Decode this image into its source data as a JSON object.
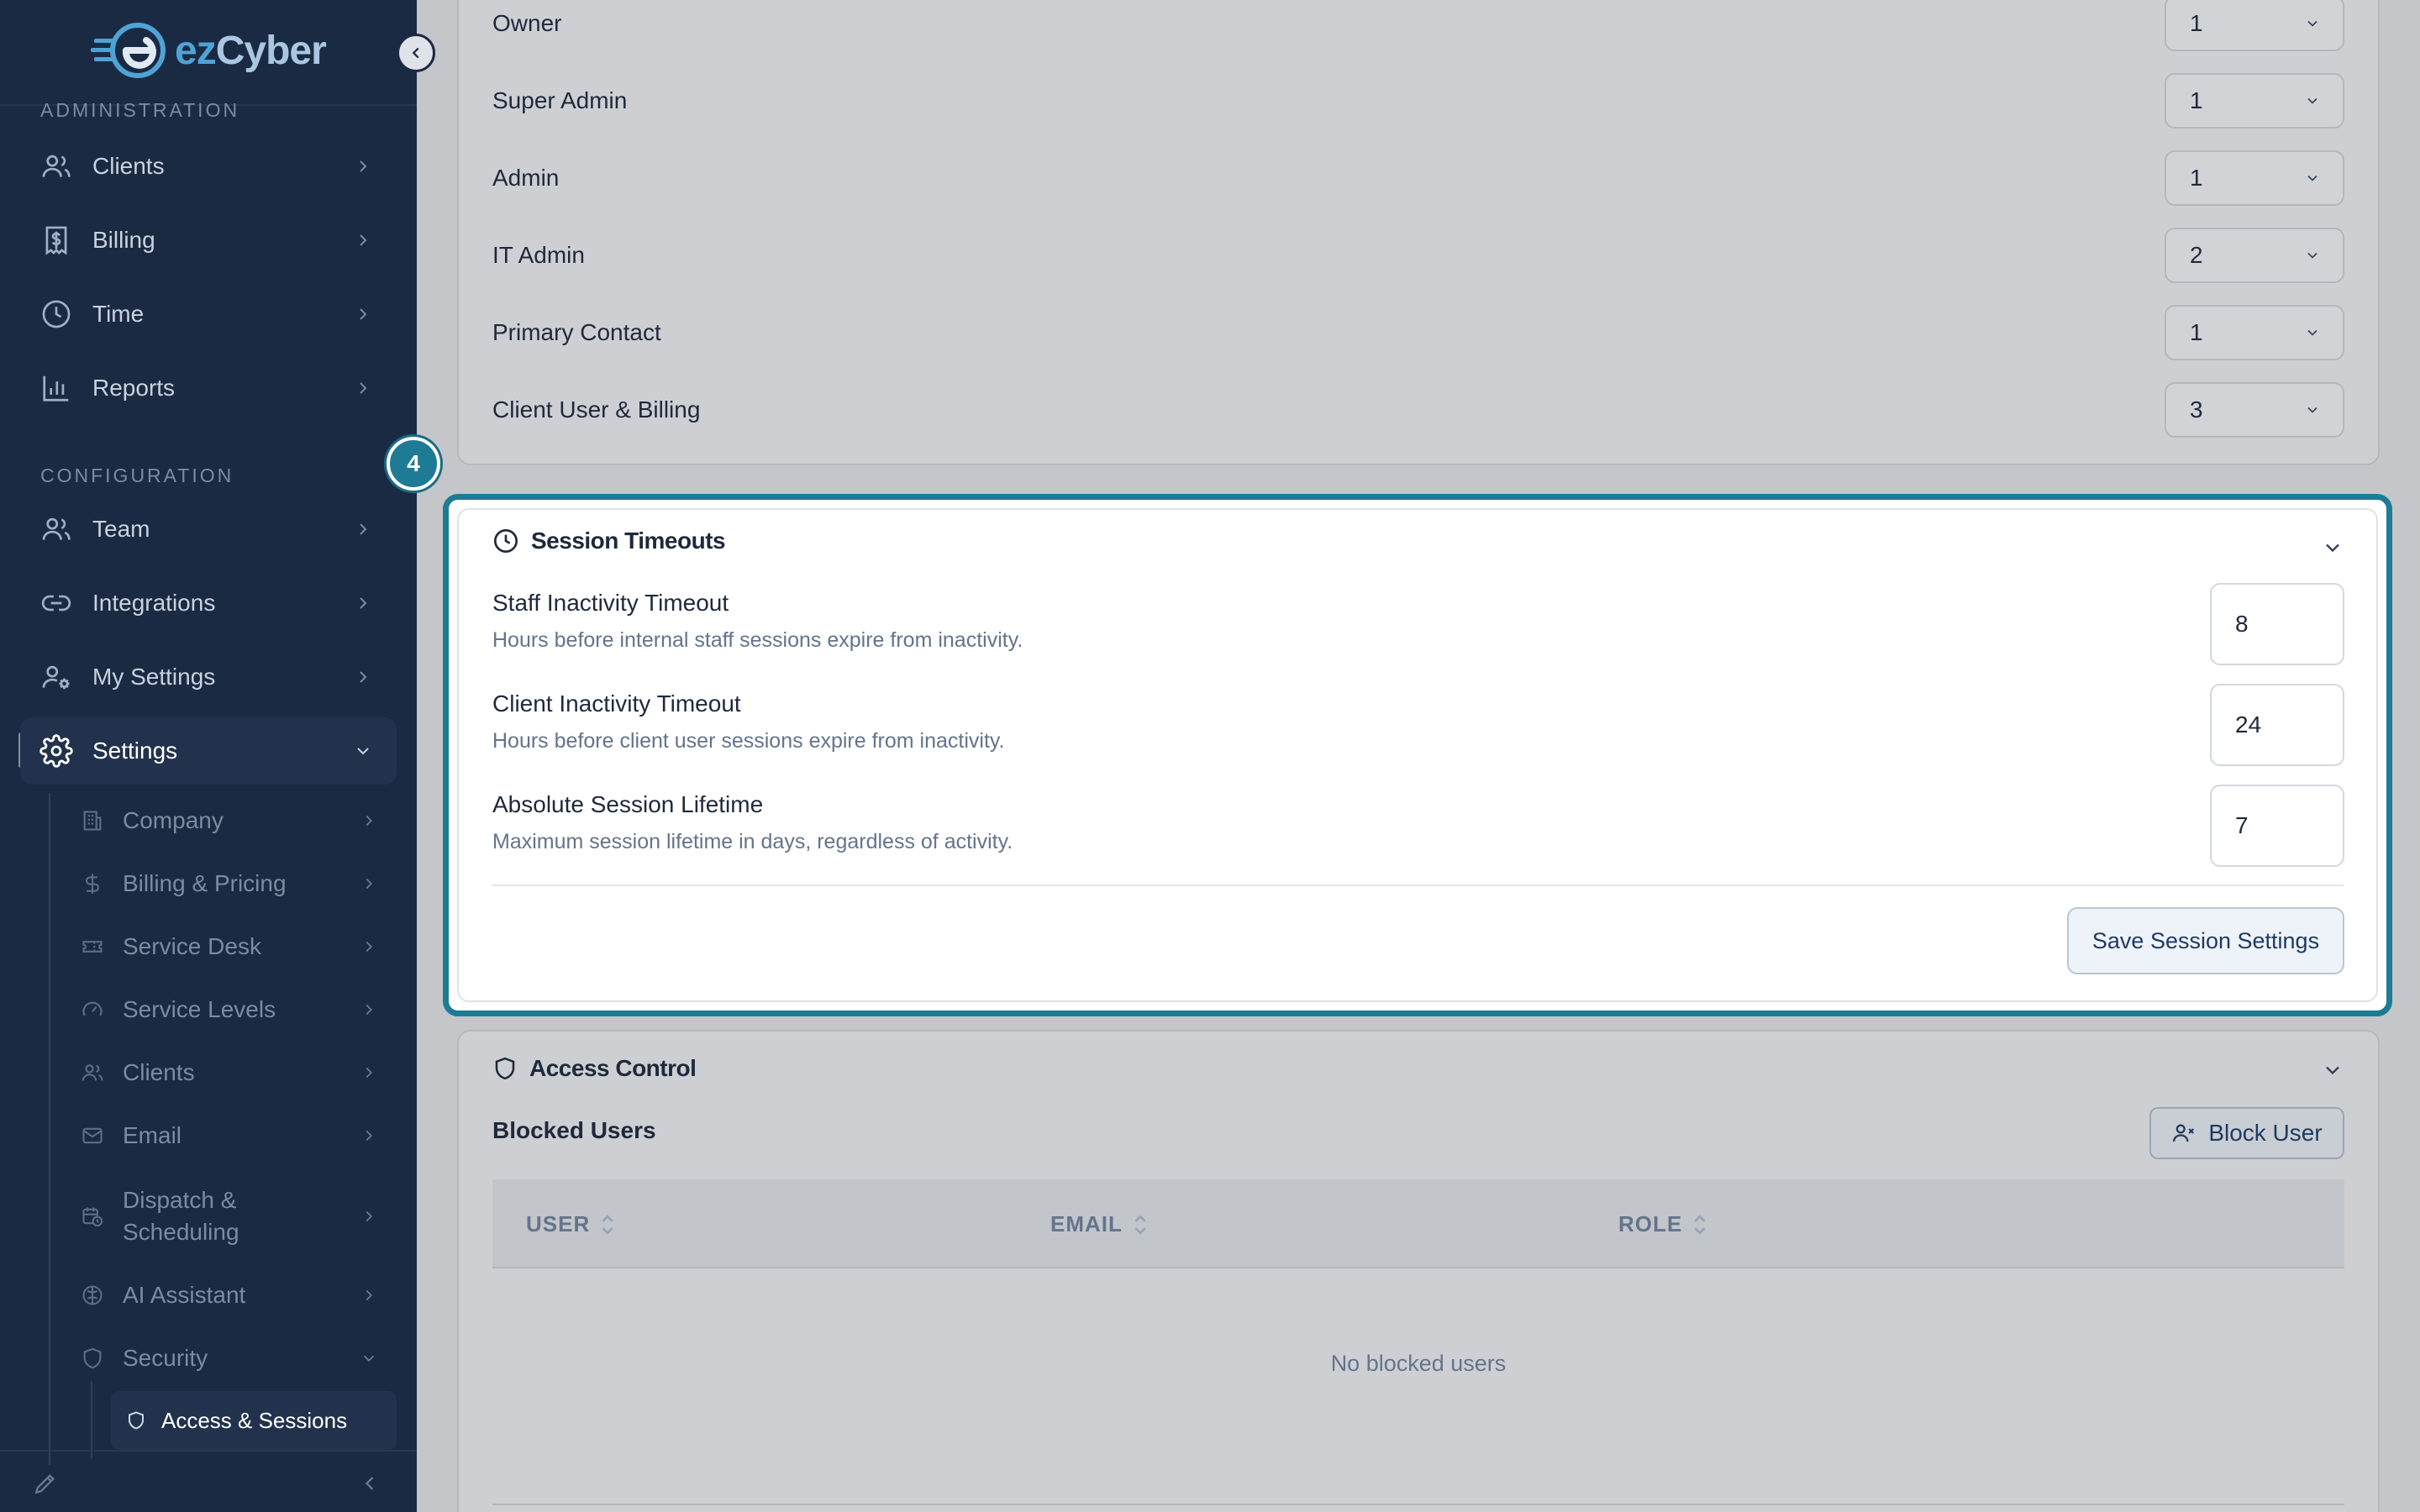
{
  "brand": {
    "logo_ez": "ez",
    "logo_cyber": "Cyber",
    "accent": "#1b7c96"
  },
  "sidebar": {
    "admin_section": "ADMINISTRATION",
    "config_section": "CONFIGURATION",
    "admin_items": [
      {
        "label": "Clients",
        "icon": "users-icon"
      },
      {
        "label": "Billing",
        "icon": "dollar-receipt-icon"
      },
      {
        "label": "Time",
        "icon": "clock-icon"
      },
      {
        "label": "Reports",
        "icon": "bar-chart-icon"
      }
    ],
    "config_items": [
      {
        "label": "Team",
        "icon": "users-icon"
      },
      {
        "label": "Integrations",
        "icon": "link-icon"
      },
      {
        "label": "My Settings",
        "icon": "user-gear-icon"
      },
      {
        "label": "Settings",
        "icon": "gear-icon",
        "active": true
      }
    ],
    "settings_sub": [
      {
        "label": "Company"
      },
      {
        "label": "Billing & Pricing"
      },
      {
        "label": "Service Desk"
      },
      {
        "label": "Service Levels"
      },
      {
        "label": "Clients"
      },
      {
        "label": "Email"
      },
      {
        "label": "Dispatch & Scheduling"
      },
      {
        "label": "AI Assistant"
      },
      {
        "label": "Security"
      }
    ],
    "security_sub": [
      {
        "label": "Access & Sessions"
      }
    ]
  },
  "roles": [
    {
      "label": "Owner",
      "value": "1"
    },
    {
      "label": "Super Admin",
      "value": "1"
    },
    {
      "label": "Admin",
      "value": "1"
    },
    {
      "label": "IT Admin",
      "value": "2"
    },
    {
      "label": "Primary Contact",
      "value": "1"
    },
    {
      "label": "Client User & Billing",
      "value": "3"
    }
  ],
  "step_badge": "4",
  "session": {
    "title": "Session Timeouts",
    "fields": [
      {
        "label": "Staff Inactivity Timeout",
        "desc": "Hours before internal staff sessions expire from inactivity.",
        "value": "8"
      },
      {
        "label": "Client Inactivity Timeout",
        "desc": "Hours before client user sessions expire from inactivity.",
        "value": "24"
      },
      {
        "label": "Absolute Session Lifetime",
        "desc": "Maximum session lifetime in days, regardless of activity.",
        "value": "7"
      }
    ],
    "save_label": "Save Session Settings"
  },
  "access": {
    "title": "Access Control",
    "blocked_label": "Blocked Users",
    "block_button": "Block User",
    "columns": [
      "USER",
      "EMAIL",
      "ROLE"
    ],
    "empty": "No blocked users"
  }
}
